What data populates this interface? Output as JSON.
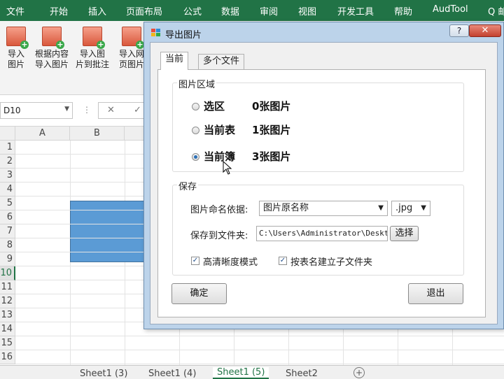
{
  "menu": [
    "文件",
    "开始",
    "插入",
    "页面布局",
    "公式",
    "数据",
    "审阅",
    "视图",
    "开发工具",
    "帮助",
    "AudTool",
    "Q 邮件"
  ],
  "ribbon": {
    "buttons": [
      {
        "line1": "导入",
        "line2": "图片"
      },
      {
        "line1": "根据内容",
        "line2": "导入图片"
      },
      {
        "line1": "导入图",
        "line2": "片到批注"
      },
      {
        "line1": "导入网",
        "line2": "页图片"
      }
    ]
  },
  "namebox": {
    "value": "D10"
  },
  "formula": {
    "cancel": "✕",
    "confirm": "✓"
  },
  "grid": {
    "columns": [
      "A",
      "B"
    ],
    "rows": [
      "1",
      "2",
      "3",
      "4",
      "5",
      "6",
      "7",
      "8",
      "9",
      "10",
      "11",
      "12",
      "13",
      "14",
      "15",
      "16"
    ],
    "selected_row": "10"
  },
  "sheets": [
    "Sheet1 (3)",
    "Sheet1 (4)",
    "Sheet1 (5)",
    "Sheet2"
  ],
  "active_sheet": "Sheet1 (5)",
  "dialog": {
    "title": "导出图片",
    "help": "?",
    "close": "✕",
    "tabs": [
      "当前",
      "多个文件"
    ],
    "picture_region": {
      "legend": "图片区域",
      "options": [
        {
          "label": "选区",
          "count": "0张图片",
          "selected": false
        },
        {
          "label": "当前表",
          "count": "1张图片",
          "selected": false
        },
        {
          "label": "当前簿",
          "count": "3张图片",
          "selected": true
        }
      ]
    },
    "save": {
      "legend": "保存",
      "naming_label": "图片命名依据:",
      "naming_value": "图片原名称",
      "format_value": ".jpg",
      "folder_label": "保存到文件夹:",
      "folder_value": "C:\\Users\\Administrator\\Desktop",
      "browse_label": "选择",
      "hd_label": "高清晰度模式",
      "hd_checked": true,
      "subfolder_label": "按表名建立子文件夹",
      "subfolder_checked": true
    },
    "ok_label": "确定",
    "exit_label": "退出"
  }
}
